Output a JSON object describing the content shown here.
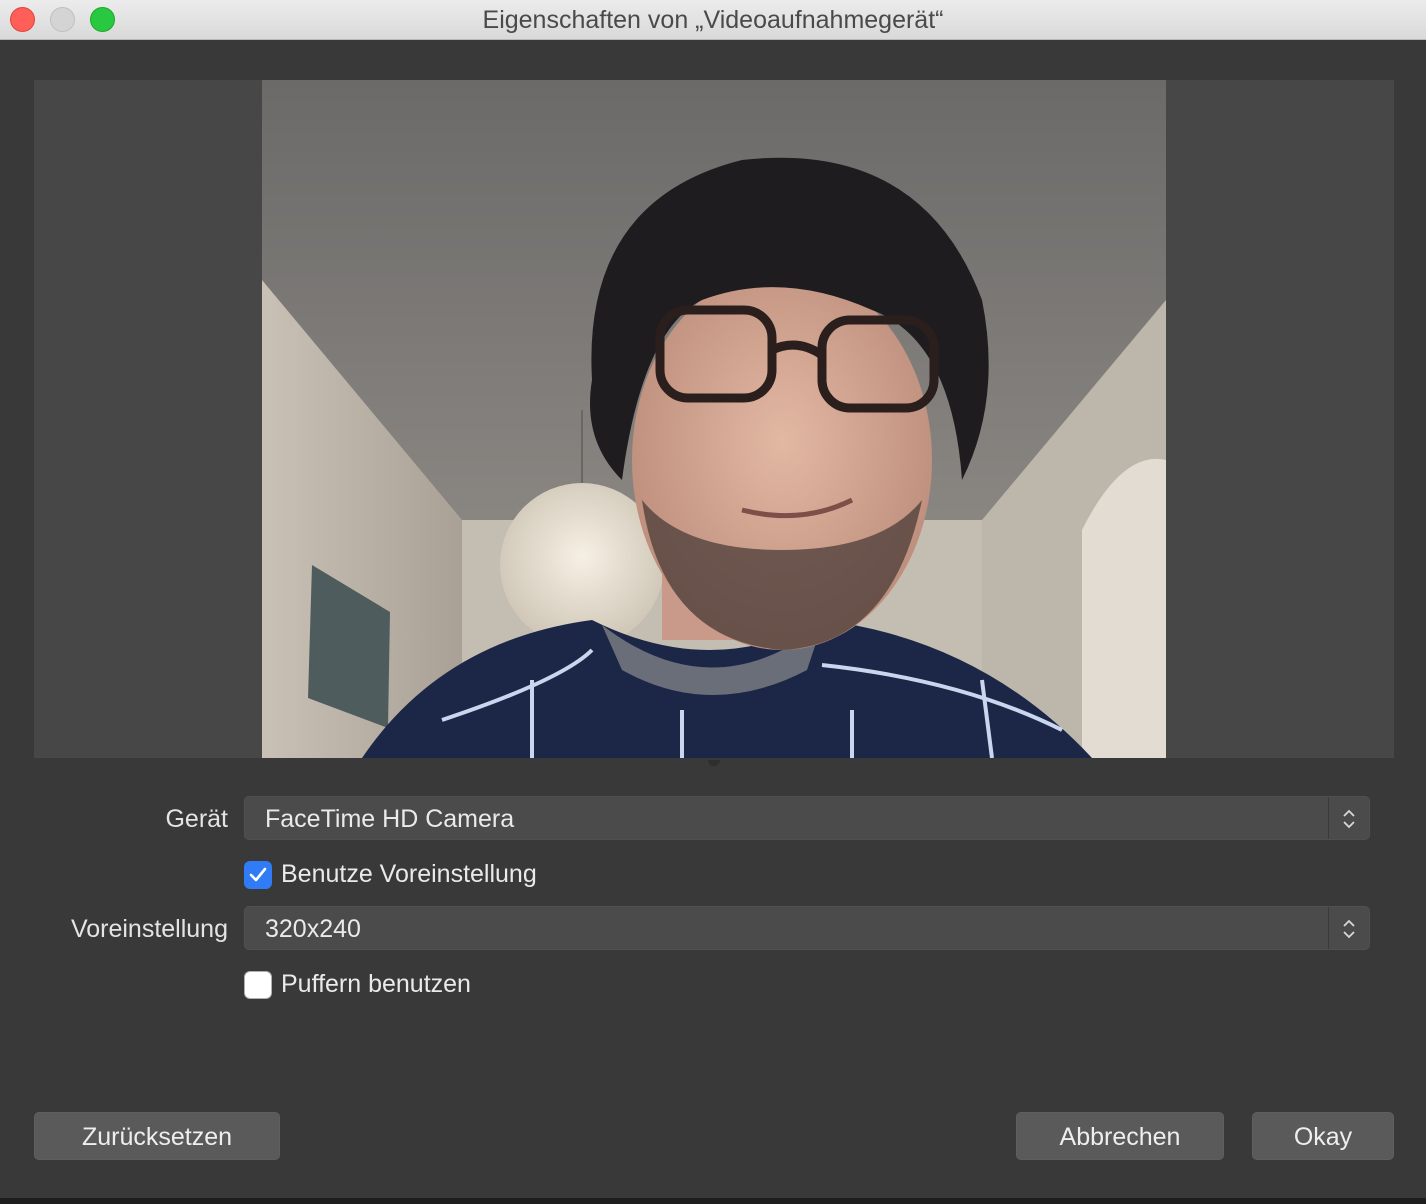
{
  "window": {
    "title": "Eigenschaften von „Videoaufnahmegerät“",
    "controls": [
      "close",
      "minimize",
      "zoom"
    ]
  },
  "form": {
    "device_label": "Gerät",
    "device_value": "FaceTime HD Camera",
    "use_preset_label": "Benutze Voreinstellung",
    "use_preset_checked": true,
    "preset_label": "Voreinstellung",
    "preset_value": "320x240",
    "buffering_label": "Puffern benutzen",
    "buffering_checked": false
  },
  "buttons": {
    "reset": "Zurücksetzen",
    "cancel": "Abbrechen",
    "ok": "Okay"
  },
  "colors": {
    "accent": "#2f7cf6",
    "close": "#fe5f57",
    "zoom": "#28c840"
  },
  "icons": {
    "stepper": "up-down-chevrons-icon",
    "check": "checkmark-icon"
  }
}
